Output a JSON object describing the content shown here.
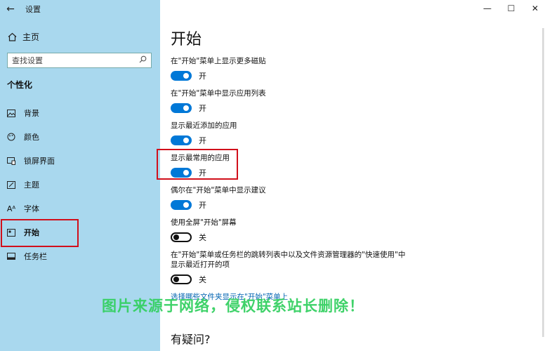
{
  "window": {
    "title": "设置",
    "back": "←",
    "controls": [
      "—",
      "☐",
      "✕"
    ]
  },
  "sidebar": {
    "home_label": "主页",
    "search_placeholder": "查找设置",
    "section": "个性化",
    "items": [
      {
        "label": "背景",
        "icon": "picture-icon"
      },
      {
        "label": "颜色",
        "icon": "palette-icon"
      },
      {
        "label": "锁屏界面",
        "icon": "lock-screen-icon"
      },
      {
        "label": "主题",
        "icon": "theme-icon"
      },
      {
        "label": "字体",
        "icon": "font-icon"
      },
      {
        "label": "开始",
        "icon": "start-icon",
        "active": true
      },
      {
        "label": "任务栏",
        "icon": "taskbar-icon"
      }
    ]
  },
  "main": {
    "title": "开始",
    "settings": [
      {
        "label": "在\"开始\"菜单上显示更多磁贴",
        "state": "开",
        "on": true
      },
      {
        "label": "在\"开始\"菜单中显示应用列表",
        "state": "开",
        "on": true
      },
      {
        "label": "显示最近添加的应用",
        "state": "开",
        "on": true
      },
      {
        "label": "显示最常用的应用",
        "state": "开",
        "on": true
      },
      {
        "label": "偶尔在\"开始\"菜单中显示建议",
        "state": "开",
        "on": true
      },
      {
        "label": "使用全屏\"开始\"屏幕",
        "state": "关",
        "on": false
      },
      {
        "label": "在\"开始\"菜单或任务栏的跳转列表中以及文件资源管理器的\"快速使用\"中",
        "label2": "显示最近打开的项",
        "state": "关",
        "on": false
      }
    ],
    "link": "选择哪些文件夹显示在\"开始\"菜单上",
    "question": "有疑问?"
  },
  "watermark": "图片来源于网络，侵权联系站长删除！",
  "colors": {
    "sidebar": "#a9d8ee",
    "accent": "#0078d7",
    "highlight": "#d10f1b",
    "watermark": "#35d062"
  }
}
